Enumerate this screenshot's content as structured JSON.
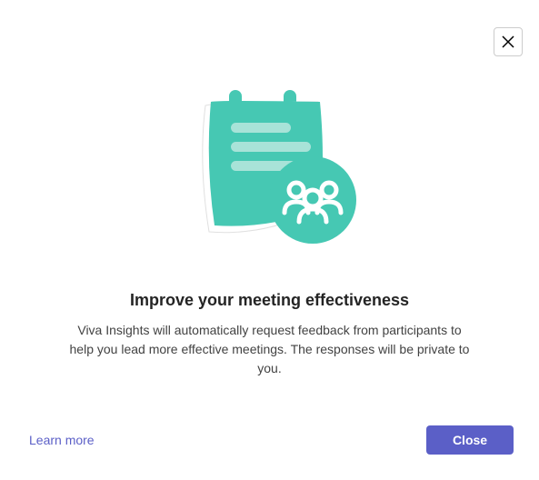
{
  "dialog": {
    "title": "Improve your meeting effectiveness",
    "description": "Viva Insights will automatically request feedback from participants to help you lead more effective meetings. The responses will be private to you.",
    "learn_more_label": "Learn more",
    "close_button_label": "Close"
  },
  "colors": {
    "primary": "#5B5FC7",
    "illustration_main": "#46C8B3",
    "illustration_light": "#A8E3D8"
  }
}
